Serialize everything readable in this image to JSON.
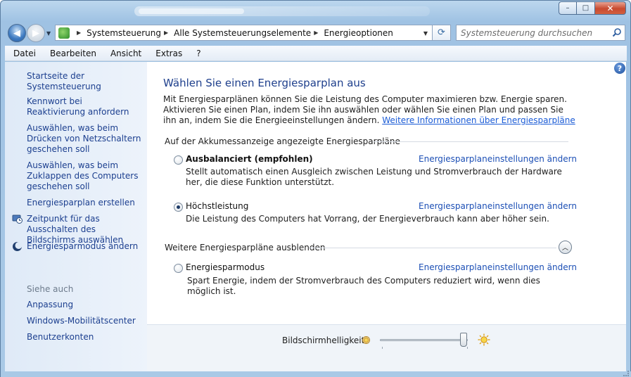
{
  "window": {
    "minimize_glyph": "–",
    "maximize_glyph": "□",
    "close_glyph": "✕"
  },
  "address": {
    "crumbs": [
      "Systemsteuerung",
      "Alle Systemsteuerungselemente",
      "Energieoptionen"
    ],
    "search_placeholder": "Systemsteuerung durchsuchen"
  },
  "menu": [
    "Datei",
    "Bearbeiten",
    "Ansicht",
    "Extras",
    "?"
  ],
  "sidebar": {
    "links": [
      "Startseite der Systemsteuerung",
      "Kennwort bei Reaktivierung anfordern",
      "Auswählen, was beim Drücken von Netzschaltern geschehen soll",
      "Auswählen, was beim Zuklappen des Computers geschehen soll",
      "Energiesparplan erstellen",
      "Zeitpunkt für das Ausschalten des Bildschirms auswählen",
      "Energiesparmodus ändern"
    ],
    "see_also": "Siehe auch",
    "see_also_links": [
      "Anpassung",
      "Windows-Mobilitätscenter",
      "Benutzerkonten"
    ]
  },
  "main": {
    "title": "Wählen Sie einen Energiesparplan aus",
    "intro": "Mit Energiesparplänen können Sie die Leistung des Computer maximieren bzw. Energie sparen. Aktivieren Sie einen Plan, indem Sie ihn auswählen oder wählen Sie einen Plan und passen Sie ihn an, indem Sie die Energieeinstellungen ändern.",
    "intro_link": "Weitere Informationen über Energiesparpläne",
    "section_shown": "Auf der Akkumessanzeige angezeigte Energiesparpläne",
    "section_hidden": "Weitere Energiesparpläne ausblenden",
    "plans": [
      {
        "name": "Ausbalanciert (empfohlen)",
        "link": "Energiesparplaneinstellungen ändern",
        "description": "Stellt automatisch einen Ausgleich zwischen Leistung und Stromverbrauch der Hardware her, die diese Funktion unterstützt.",
        "selected": false
      },
      {
        "name": "Höchstleistung",
        "link": "Energiesparplaneinstellungen ändern",
        "description": "Die Leistung des Computers hat Vorrang, der Energieverbrauch kann aber höher sein.",
        "selected": true
      },
      {
        "name": "Energiesparmodus",
        "link": "Energiesparplaneinstellungen ändern",
        "description": "Spart Energie, indem der Stromverbrauch des Computers reduziert wird, wenn dies möglich ist.",
        "selected": false
      }
    ]
  },
  "brightness": {
    "label": "Bildschirmhelligkeit:",
    "level": 0.97
  },
  "colors": {
    "link": "#1c3f8f",
    "title": "#1e3f8c",
    "sidebar_bg": "#dfeaf7"
  }
}
